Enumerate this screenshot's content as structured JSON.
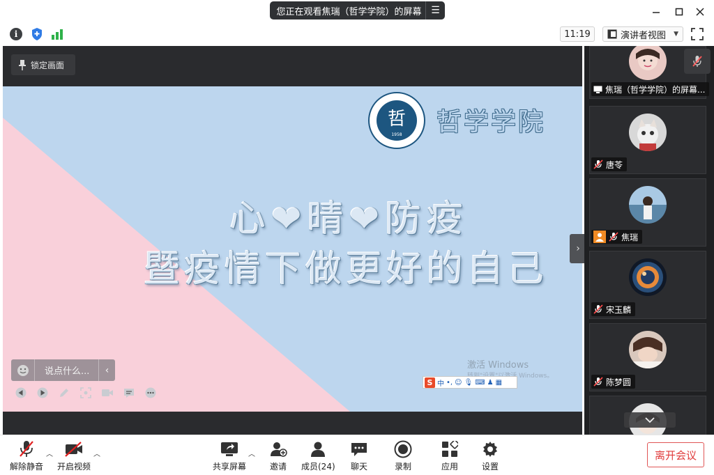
{
  "window": {
    "share_banner": "您正在观看焦瑞（哲学学院）的屏幕",
    "minimize_icon": "minimize-icon",
    "maximize_icon": "maximize-icon",
    "close_icon": "close-icon"
  },
  "infobar": {
    "time": "11:19",
    "view_mode": "演讲者视图"
  },
  "stage": {
    "lock_label": "锁定画面",
    "slide": {
      "college_name": "哲学学院",
      "logo_year": "1958",
      "logo_char": "哲",
      "headline_line1": "心❤晴❤防疫",
      "headline_line2": "暨疫情下做更好的自己",
      "watermark_title": "激活 Windows",
      "watermark_sub": "转到\"设置\"以激活 Windows。",
      "ime_label": "中"
    },
    "chat_placeholder": "说点什么..."
  },
  "participants": [
    {
      "name": "焦瑞（哲学学院）的屏幕...",
      "type": "screen"
    },
    {
      "name": "唐苓",
      "type": "muted"
    },
    {
      "name": "焦瑞",
      "type": "host-muted"
    },
    {
      "name": "宋玉麟",
      "type": "muted"
    },
    {
      "name": "陈梦圆",
      "type": "muted"
    }
  ],
  "toolbar": {
    "unmute": "解除静音",
    "start_video": "开启视频",
    "share_screen": "共享屏幕",
    "invite": "邀请",
    "members": "成员(24)",
    "chat": "聊天",
    "record": "录制",
    "apps": "应用",
    "settings": "设置",
    "leave": "离开会议"
  },
  "colors": {
    "slide_blue": "#bdd6ee",
    "slide_pink": "#f9d0da",
    "leave_red": "#e03a3a",
    "logo_navy": "#1d5680"
  }
}
